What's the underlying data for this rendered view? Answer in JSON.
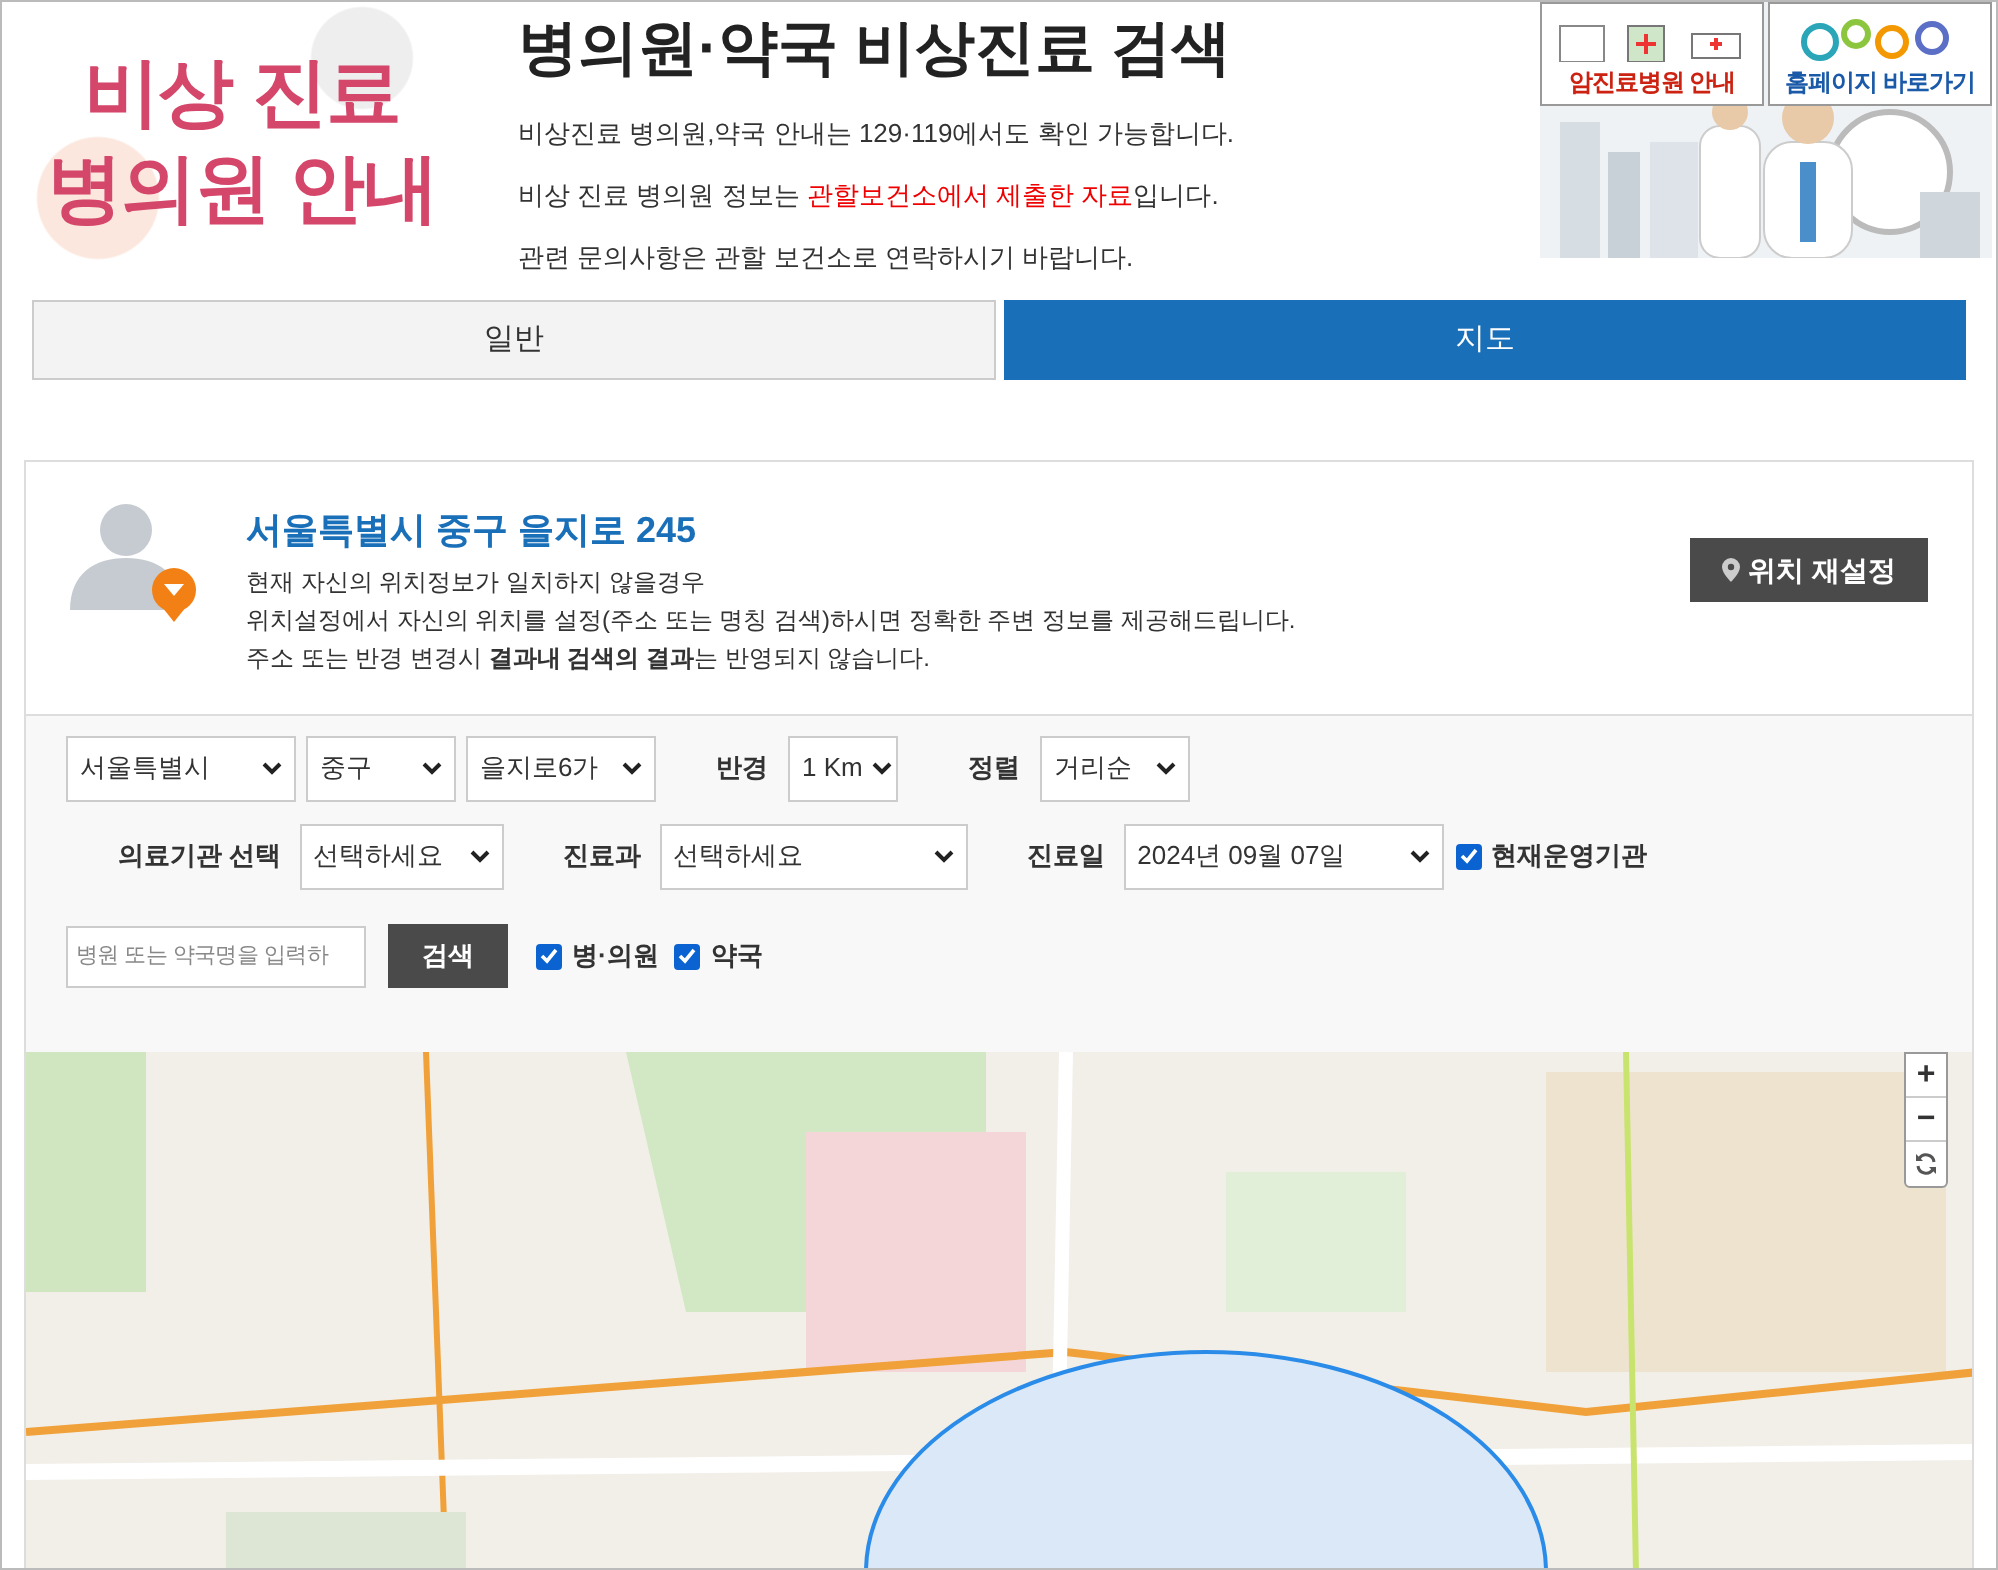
{
  "header": {
    "logo_lines": [
      "비상 진료",
      "병의원 안내"
    ],
    "title": "병의원·약국 비상진료 검색",
    "notes": [
      {
        "segments": [
          {
            "text": "비상진료 병의원,약국 안내는 129·119에서도 확인 가능합니다.",
            "highlight": false
          }
        ]
      },
      {
        "segments": [
          {
            "text": "비상 진료 병의원 정보는 ",
            "highlight": false
          },
          {
            "text": "관할보건소에서 제출한 자료",
            "highlight": true
          },
          {
            "text": "입니다.",
            "highlight": false
          }
        ]
      },
      {
        "segments": [
          {
            "text": "관련 문의사항은 관할 보건소로 연락하시기 바랍니다.",
            "highlight": false
          }
        ]
      }
    ],
    "banners": [
      {
        "label": "암진료병원 안내",
        "kind": "hospital"
      },
      {
        "label": "홈페이지 바로가기",
        "kind": "homepage"
      }
    ]
  },
  "tabs": [
    {
      "label": "일반",
      "selected": false
    },
    {
      "label": "지도",
      "selected": true
    }
  ],
  "location": {
    "address": "서울특별시 중구 을지로 245",
    "lines": [
      "현재 자신의 위치정보가 일치하지 않을경우",
      "위치설정에서 자신의 위치를 설정(주소 또는 명칭 검색)하시면 정확한 주변 정보를 제공해드립니다.",
      "주소 또는 반경 변경시 **결과내 검색의 결과**는 반영되지 않습니다."
    ],
    "button": "위치 재설정"
  },
  "filters": {
    "city": "서울특별시",
    "district": "중구",
    "dong": "을지로6가",
    "radius_label": "반경",
    "radius": "1 Km",
    "sort_label": "정렬",
    "sort": "거리순",
    "type_label": "의료기관 선택",
    "type": "선택하세요",
    "dept_label": "진료과",
    "dept": "선택하세요",
    "date_label": "진료일",
    "date": "2024년 09월 07일",
    "open_now": {
      "label": "현재운영기관",
      "checked": true
    },
    "search_placeholder": "병원 또는 약국명을 입력하",
    "search_button": "검색",
    "kinds": [
      {
        "label": "병·의원",
        "checked": true
      },
      {
        "label": "약국",
        "checked": true
      }
    ]
  },
  "map": {
    "kind": "picture",
    "controls": [
      "+",
      "−"
    ]
  }
}
